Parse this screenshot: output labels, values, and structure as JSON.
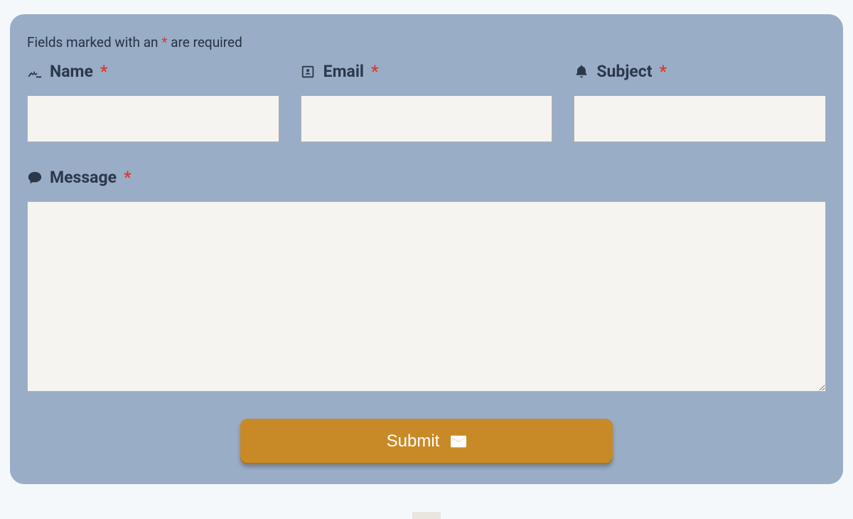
{
  "instruction": {
    "prefix": "Fields marked with an ",
    "mark": "*",
    "suffix": " are required"
  },
  "fields": {
    "name": {
      "label": "Name",
      "required_mark": "*",
      "value": "",
      "placeholder": ""
    },
    "email": {
      "label": "Email",
      "required_mark": "*",
      "value": "",
      "placeholder": ""
    },
    "subject": {
      "label": "Subject",
      "required_mark": "*",
      "value": "",
      "placeholder": ""
    },
    "message": {
      "label": "Message",
      "required_mark": "*",
      "value": "",
      "placeholder": ""
    }
  },
  "submit": {
    "label": "Submit"
  },
  "colors": {
    "card_bg": "#99adc7",
    "text": "#2b3849",
    "required": "#d93a2b",
    "input_bg": "#f6f4f1",
    "input_border": "#b6aea4",
    "button_bg": "#c88a27",
    "button_text": "#ffffff"
  }
}
